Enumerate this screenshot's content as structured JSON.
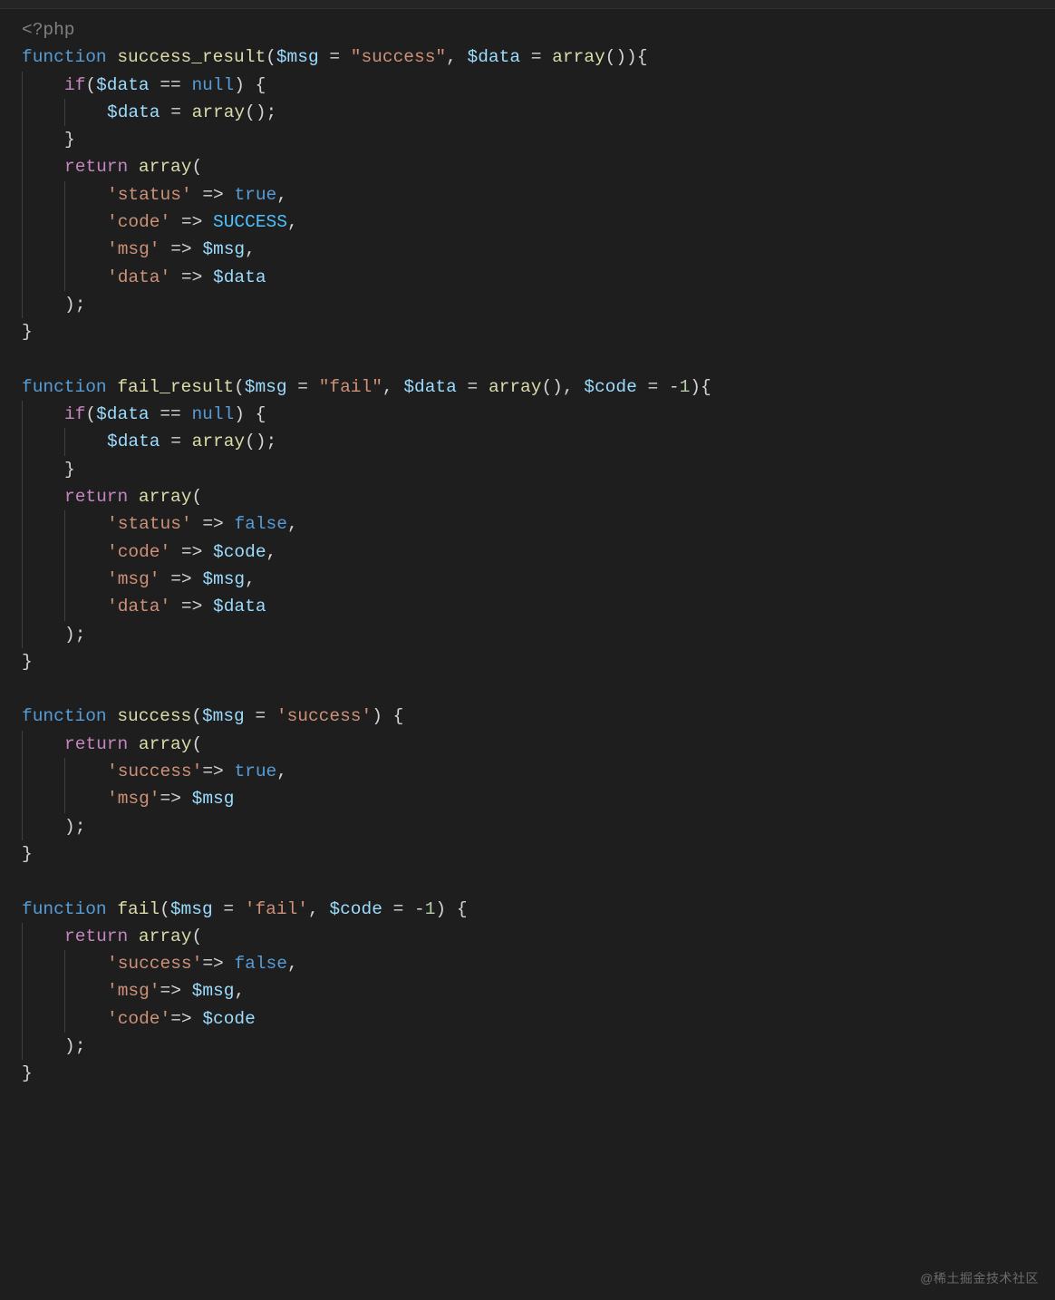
{
  "watermark": "@稀土掘金技术社区",
  "code": {
    "lines": [
      {
        "indent": 0,
        "tokens": [
          {
            "cls": "tag",
            "t": "<?php"
          }
        ]
      },
      {
        "indent": 0,
        "tokens": [
          {
            "cls": "kw",
            "t": "function"
          },
          {
            "cls": "pn",
            "t": " "
          },
          {
            "cls": "fn",
            "t": "success_result"
          },
          {
            "cls": "pn",
            "t": "("
          },
          {
            "cls": "var",
            "t": "$msg"
          },
          {
            "cls": "pn",
            "t": " "
          },
          {
            "cls": "op",
            "t": "="
          },
          {
            "cls": "pn",
            "t": " "
          },
          {
            "cls": "str",
            "t": "\"success\""
          },
          {
            "cls": "pn",
            "t": ", "
          },
          {
            "cls": "var",
            "t": "$data"
          },
          {
            "cls": "pn",
            "t": " "
          },
          {
            "cls": "op",
            "t": "="
          },
          {
            "cls": "pn",
            "t": " "
          },
          {
            "cls": "fn",
            "t": "array"
          },
          {
            "cls": "pn",
            "t": "()){"
          }
        ]
      },
      {
        "indent": 1,
        "tokens": [
          {
            "cls": "kwret",
            "t": "if"
          },
          {
            "cls": "pn",
            "t": "("
          },
          {
            "cls": "var",
            "t": "$data"
          },
          {
            "cls": "pn",
            "t": " "
          },
          {
            "cls": "op",
            "t": "=="
          },
          {
            "cls": "pn",
            "t": " "
          },
          {
            "cls": "kw",
            "t": "null"
          },
          {
            "cls": "pn",
            "t": ") {"
          }
        ]
      },
      {
        "indent": 2,
        "tokens": [
          {
            "cls": "var",
            "t": "$data"
          },
          {
            "cls": "pn",
            "t": " "
          },
          {
            "cls": "op",
            "t": "="
          },
          {
            "cls": "pn",
            "t": " "
          },
          {
            "cls": "fn",
            "t": "array"
          },
          {
            "cls": "pn",
            "t": "();"
          }
        ]
      },
      {
        "indent": 1,
        "tokens": [
          {
            "cls": "pn",
            "t": "}"
          }
        ]
      },
      {
        "indent": 1,
        "tokens": [
          {
            "cls": "kwret",
            "t": "return"
          },
          {
            "cls": "pn",
            "t": " "
          },
          {
            "cls": "fn",
            "t": "array"
          },
          {
            "cls": "pn",
            "t": "("
          }
        ]
      },
      {
        "indent": 2,
        "tokens": [
          {
            "cls": "str",
            "t": "'status'"
          },
          {
            "cls": "pn",
            "t": " "
          },
          {
            "cls": "op",
            "t": "=>"
          },
          {
            "cls": "pn",
            "t": " "
          },
          {
            "cls": "kw",
            "t": "true"
          },
          {
            "cls": "pn",
            "t": ","
          }
        ]
      },
      {
        "indent": 2,
        "tokens": [
          {
            "cls": "str",
            "t": "'code'"
          },
          {
            "cls": "pn",
            "t": " "
          },
          {
            "cls": "op",
            "t": "=>"
          },
          {
            "cls": "pn",
            "t": " "
          },
          {
            "cls": "const",
            "t": "SUCCESS"
          },
          {
            "cls": "pn",
            "t": ","
          }
        ]
      },
      {
        "indent": 2,
        "tokens": [
          {
            "cls": "str",
            "t": "'msg'"
          },
          {
            "cls": "pn",
            "t": " "
          },
          {
            "cls": "op",
            "t": "=>"
          },
          {
            "cls": "pn",
            "t": " "
          },
          {
            "cls": "var",
            "t": "$msg"
          },
          {
            "cls": "pn",
            "t": ","
          }
        ]
      },
      {
        "indent": 2,
        "tokens": [
          {
            "cls": "str",
            "t": "'data'"
          },
          {
            "cls": "pn",
            "t": " "
          },
          {
            "cls": "op",
            "t": "=>"
          },
          {
            "cls": "pn",
            "t": " "
          },
          {
            "cls": "var",
            "t": "$data"
          }
        ]
      },
      {
        "indent": 1,
        "tokens": [
          {
            "cls": "pn",
            "t": ");"
          }
        ]
      },
      {
        "indent": 0,
        "tokens": [
          {
            "cls": "pn",
            "t": "}"
          }
        ]
      },
      {
        "indent": 0,
        "tokens": []
      },
      {
        "indent": 0,
        "tokens": [
          {
            "cls": "kw",
            "t": "function"
          },
          {
            "cls": "pn",
            "t": " "
          },
          {
            "cls": "fn",
            "t": "fail_result"
          },
          {
            "cls": "pn",
            "t": "("
          },
          {
            "cls": "var",
            "t": "$msg"
          },
          {
            "cls": "pn",
            "t": " "
          },
          {
            "cls": "op",
            "t": "="
          },
          {
            "cls": "pn",
            "t": " "
          },
          {
            "cls": "str",
            "t": "\"fail\""
          },
          {
            "cls": "pn",
            "t": ", "
          },
          {
            "cls": "var",
            "t": "$data"
          },
          {
            "cls": "pn",
            "t": " "
          },
          {
            "cls": "op",
            "t": "="
          },
          {
            "cls": "pn",
            "t": " "
          },
          {
            "cls": "fn",
            "t": "array"
          },
          {
            "cls": "pn",
            "t": "(), "
          },
          {
            "cls": "var",
            "t": "$code"
          },
          {
            "cls": "pn",
            "t": " "
          },
          {
            "cls": "op",
            "t": "="
          },
          {
            "cls": "pn",
            "t": " "
          },
          {
            "cls": "op",
            "t": "-"
          },
          {
            "cls": "num",
            "t": "1"
          },
          {
            "cls": "pn",
            "t": "){"
          }
        ]
      },
      {
        "indent": 1,
        "tokens": [
          {
            "cls": "kwret",
            "t": "if"
          },
          {
            "cls": "pn",
            "t": "("
          },
          {
            "cls": "var",
            "t": "$data"
          },
          {
            "cls": "pn",
            "t": " "
          },
          {
            "cls": "op",
            "t": "=="
          },
          {
            "cls": "pn",
            "t": " "
          },
          {
            "cls": "kw",
            "t": "null"
          },
          {
            "cls": "pn",
            "t": ") {"
          }
        ]
      },
      {
        "indent": 2,
        "tokens": [
          {
            "cls": "var",
            "t": "$data"
          },
          {
            "cls": "pn",
            "t": " "
          },
          {
            "cls": "op",
            "t": "="
          },
          {
            "cls": "pn",
            "t": " "
          },
          {
            "cls": "fn",
            "t": "array"
          },
          {
            "cls": "pn",
            "t": "();"
          }
        ]
      },
      {
        "indent": 1,
        "tokens": [
          {
            "cls": "pn",
            "t": "}"
          }
        ]
      },
      {
        "indent": 1,
        "tokens": [
          {
            "cls": "kwret",
            "t": "return"
          },
          {
            "cls": "pn",
            "t": " "
          },
          {
            "cls": "fn",
            "t": "array"
          },
          {
            "cls": "pn",
            "t": "("
          }
        ]
      },
      {
        "indent": 2,
        "tokens": [
          {
            "cls": "str",
            "t": "'status'"
          },
          {
            "cls": "pn",
            "t": " "
          },
          {
            "cls": "op",
            "t": "=>"
          },
          {
            "cls": "pn",
            "t": " "
          },
          {
            "cls": "kw",
            "t": "false"
          },
          {
            "cls": "pn",
            "t": ","
          }
        ]
      },
      {
        "indent": 2,
        "tokens": [
          {
            "cls": "str",
            "t": "'code'"
          },
          {
            "cls": "pn",
            "t": " "
          },
          {
            "cls": "op",
            "t": "=>"
          },
          {
            "cls": "pn",
            "t": " "
          },
          {
            "cls": "var",
            "t": "$code"
          },
          {
            "cls": "pn",
            "t": ","
          }
        ]
      },
      {
        "indent": 2,
        "tokens": [
          {
            "cls": "str",
            "t": "'msg'"
          },
          {
            "cls": "pn",
            "t": " "
          },
          {
            "cls": "op",
            "t": "=>"
          },
          {
            "cls": "pn",
            "t": " "
          },
          {
            "cls": "var",
            "t": "$msg"
          },
          {
            "cls": "pn",
            "t": ","
          }
        ]
      },
      {
        "indent": 2,
        "tokens": [
          {
            "cls": "str",
            "t": "'data'"
          },
          {
            "cls": "pn",
            "t": " "
          },
          {
            "cls": "op",
            "t": "=>"
          },
          {
            "cls": "pn",
            "t": " "
          },
          {
            "cls": "var",
            "t": "$data"
          }
        ]
      },
      {
        "indent": 1,
        "tokens": [
          {
            "cls": "pn",
            "t": ");"
          }
        ]
      },
      {
        "indent": 0,
        "tokens": [
          {
            "cls": "pn",
            "t": "}"
          }
        ]
      },
      {
        "indent": 0,
        "tokens": []
      },
      {
        "indent": 0,
        "tokens": [
          {
            "cls": "kw",
            "t": "function"
          },
          {
            "cls": "pn",
            "t": " "
          },
          {
            "cls": "fn",
            "t": "success"
          },
          {
            "cls": "pn",
            "t": "("
          },
          {
            "cls": "var",
            "t": "$msg"
          },
          {
            "cls": "pn",
            "t": " "
          },
          {
            "cls": "op",
            "t": "="
          },
          {
            "cls": "pn",
            "t": " "
          },
          {
            "cls": "str",
            "t": "'success'"
          },
          {
            "cls": "pn",
            "t": ") {"
          }
        ]
      },
      {
        "indent": 1,
        "tokens": [
          {
            "cls": "kwret",
            "t": "return"
          },
          {
            "cls": "pn",
            "t": " "
          },
          {
            "cls": "fn",
            "t": "array"
          },
          {
            "cls": "pn",
            "t": "("
          }
        ]
      },
      {
        "indent": 2,
        "tokens": [
          {
            "cls": "str",
            "t": "'success'"
          },
          {
            "cls": "op",
            "t": "=>"
          },
          {
            "cls": "pn",
            "t": " "
          },
          {
            "cls": "kw",
            "t": "true"
          },
          {
            "cls": "pn",
            "t": ","
          }
        ]
      },
      {
        "indent": 2,
        "tokens": [
          {
            "cls": "str",
            "t": "'msg'"
          },
          {
            "cls": "op",
            "t": "=>"
          },
          {
            "cls": "pn",
            "t": " "
          },
          {
            "cls": "var",
            "t": "$msg"
          }
        ]
      },
      {
        "indent": 1,
        "tokens": [
          {
            "cls": "pn",
            "t": ");"
          }
        ]
      },
      {
        "indent": 0,
        "tokens": [
          {
            "cls": "pn",
            "t": "}"
          }
        ]
      },
      {
        "indent": 0,
        "tokens": []
      },
      {
        "indent": 0,
        "tokens": [
          {
            "cls": "kw",
            "t": "function"
          },
          {
            "cls": "pn",
            "t": " "
          },
          {
            "cls": "fn",
            "t": "fail"
          },
          {
            "cls": "pn",
            "t": "("
          },
          {
            "cls": "var",
            "t": "$msg"
          },
          {
            "cls": "pn",
            "t": " "
          },
          {
            "cls": "op",
            "t": "="
          },
          {
            "cls": "pn",
            "t": " "
          },
          {
            "cls": "str",
            "t": "'fail'"
          },
          {
            "cls": "pn",
            "t": ", "
          },
          {
            "cls": "var",
            "t": "$code"
          },
          {
            "cls": "pn",
            "t": " "
          },
          {
            "cls": "op",
            "t": "="
          },
          {
            "cls": "pn",
            "t": " "
          },
          {
            "cls": "op",
            "t": "-"
          },
          {
            "cls": "num",
            "t": "1"
          },
          {
            "cls": "pn",
            "t": ") {"
          }
        ]
      },
      {
        "indent": 1,
        "tokens": [
          {
            "cls": "kwret",
            "t": "return"
          },
          {
            "cls": "pn",
            "t": " "
          },
          {
            "cls": "fn",
            "t": "array"
          },
          {
            "cls": "pn",
            "t": "("
          }
        ]
      },
      {
        "indent": 2,
        "tokens": [
          {
            "cls": "str",
            "t": "'success'"
          },
          {
            "cls": "op",
            "t": "=>"
          },
          {
            "cls": "pn",
            "t": " "
          },
          {
            "cls": "kw",
            "t": "false"
          },
          {
            "cls": "pn",
            "t": ","
          }
        ]
      },
      {
        "indent": 2,
        "tokens": [
          {
            "cls": "str",
            "t": "'msg'"
          },
          {
            "cls": "op",
            "t": "=>"
          },
          {
            "cls": "pn",
            "t": " "
          },
          {
            "cls": "var",
            "t": "$msg"
          },
          {
            "cls": "pn",
            "t": ","
          }
        ]
      },
      {
        "indent": 2,
        "tokens": [
          {
            "cls": "str",
            "t": "'code'"
          },
          {
            "cls": "op",
            "t": "=>"
          },
          {
            "cls": "pn",
            "t": " "
          },
          {
            "cls": "var",
            "t": "$code"
          }
        ]
      },
      {
        "indent": 1,
        "tokens": [
          {
            "cls": "pn",
            "t": ");"
          }
        ]
      },
      {
        "indent": 0,
        "tokens": [
          {
            "cls": "pn",
            "t": "}"
          }
        ]
      }
    ]
  }
}
